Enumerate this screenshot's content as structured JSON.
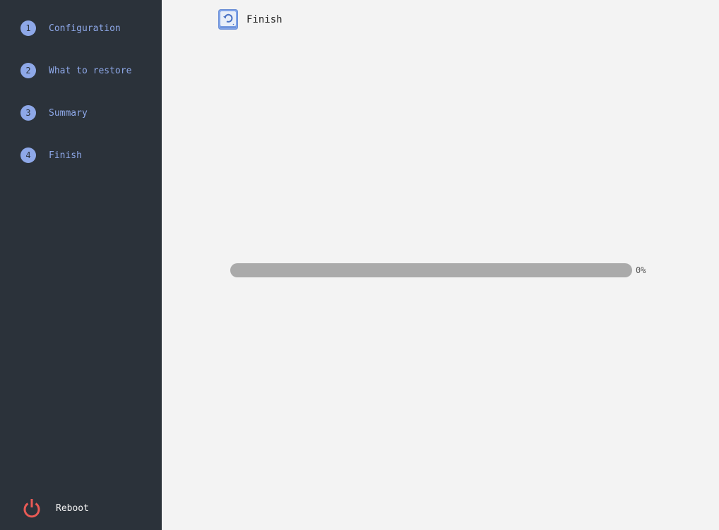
{
  "sidebar": {
    "steps": [
      {
        "number": "1",
        "label": "Configuration"
      },
      {
        "number": "2",
        "label": "What to restore"
      },
      {
        "number": "3",
        "label": "Summary"
      },
      {
        "number": "4",
        "label": "Finish"
      }
    ],
    "reboot_label": "Reboot",
    "reboot_icon": "power-icon"
  },
  "header": {
    "title": "Finish",
    "icon": "restore-icon"
  },
  "progress": {
    "value": 0,
    "label": "0%"
  },
  "colors": {
    "sidebar_bg": "#2b323a",
    "accent": "#8ea8e8",
    "reboot_red": "#e85a55",
    "content_bg": "#f3f3f3",
    "progress_track": "#aaaaaa"
  }
}
